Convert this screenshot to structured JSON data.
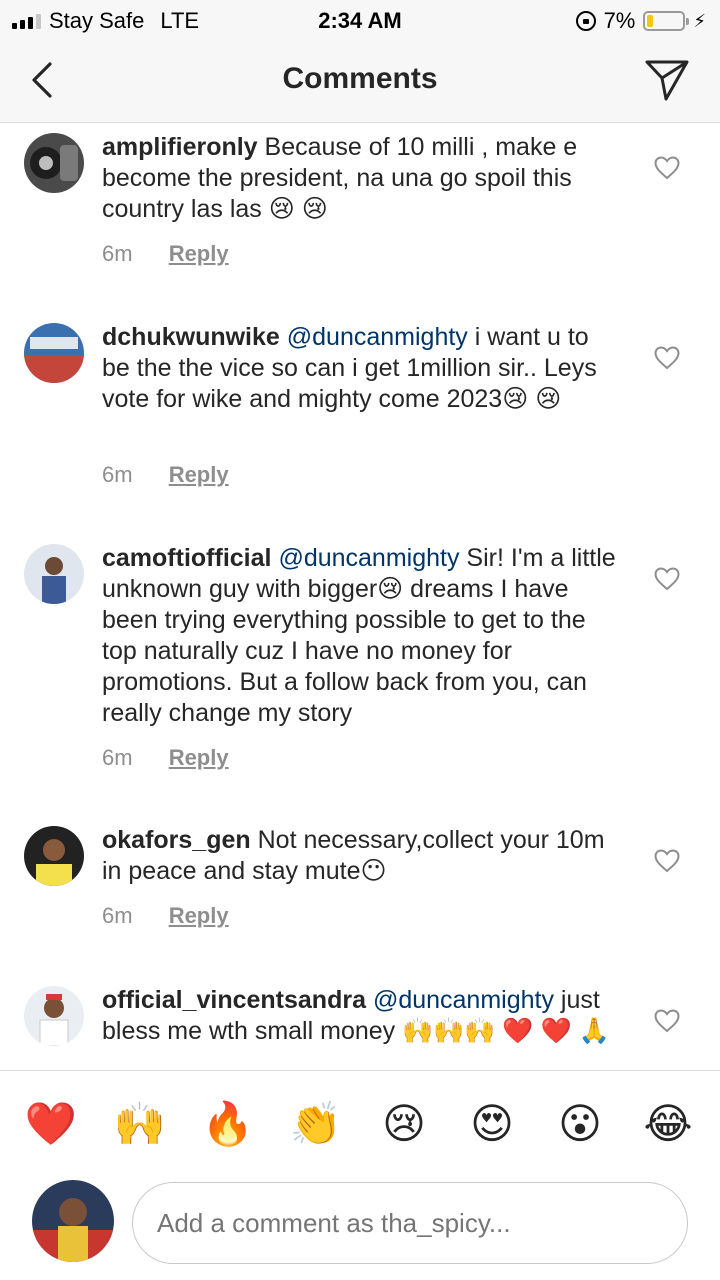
{
  "status_bar": {
    "carrier": "Stay Safe",
    "network": "LTE",
    "time": "2:34 AM",
    "battery_pct": "7%",
    "battery_level": 0.07,
    "signal_bars": 3
  },
  "header": {
    "title": "Comments",
    "back_icon": "chevron-left-icon",
    "send_icon": "paper-plane-icon"
  },
  "comments": [
    {
      "username": "amplifieronly",
      "mention": "",
      "text": "Because of 10 milli , make e become the president, na una go spoil this country las las 😢 😢",
      "time": "6m",
      "reply_label": "Reply"
    },
    {
      "username": "dchukwunwike",
      "mention": "@duncanmighty",
      "text": "i want u to be the the vice so can i get 1million sir.. Leys vote for wike and mighty come 2023😢 😢",
      "time": "6m",
      "reply_label": "Reply"
    },
    {
      "username": "camoftiofficial",
      "mention": "@duncanmighty",
      "text": "Sir! I'm a little unknown guy with bigger😢 dreams  I have been trying everything possible  to get to the top naturally cuz I have no money for promotions. But a follow back from you,  can really change my story",
      "time": "6m",
      "reply_label": "Reply"
    },
    {
      "username": "okafors_gen",
      "mention": "",
      "text": "Not necessary,collect your 10m in peace and stay mute😶",
      "time": "6m",
      "reply_label": "Reply"
    },
    {
      "username": "official_vincentsandra",
      "mention": "@duncanmighty",
      "text": "just bless me wth small money 🙌🙌🙌 ❤️ ❤️ 🙏",
      "time": "",
      "reply_label": ""
    }
  ],
  "emoji_bar": [
    "❤️",
    "🙌",
    "🔥",
    "👏",
    "😢",
    "😍",
    "😮",
    "😂"
  ],
  "input": {
    "placeholder": "Add a comment as tha_spicy..."
  },
  "colors": {
    "mention": "#003569",
    "meta": "#8e8e8e",
    "battery_fill": "#f5c518"
  }
}
